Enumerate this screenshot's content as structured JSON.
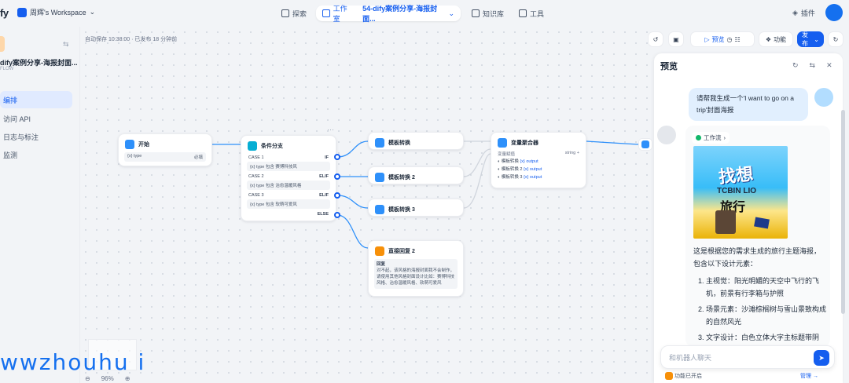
{
  "header": {
    "logo": "fy",
    "workspace": "周辉's Workspace",
    "nav": {
      "explore": "探索",
      "studio": "工作室",
      "app_title": "54-dify案例分享-海报封面...",
      "knowledge": "知识库",
      "tools": "工具"
    },
    "plugins": "插件"
  },
  "sidebar": {
    "app_name": "dify案例分享-海报封面...",
    "app_type": "FLOW",
    "items": [
      {
        "label": "编排"
      },
      {
        "label": "访问 API"
      },
      {
        "label": "日志与标注"
      },
      {
        "label": "监测"
      }
    ]
  },
  "canvas": {
    "autosave": "自动保存 10:38:00 · 已发布 18 分钟前",
    "zoom": "96%",
    "nodes": {
      "start": {
        "title": "开始",
        "var": "{x} type",
        "req": "必填"
      },
      "if": {
        "title": "条件分支",
        "case1": "CASE 1",
        "if": "IF",
        "cond1": "{x} type 包含 赛博科技风",
        "case2": "CASE 2",
        "elif1": "ELIF",
        "cond2": "{x} type 包含 治愈温暖风格",
        "case3": "CASE 3",
        "elif2": "ELIF",
        "cond3": "{x} type 包含 软萌可爱风",
        "else": "ELSE"
      },
      "t1": {
        "title": "模板转换"
      },
      "t2": {
        "title": "模板转换 2"
      },
      "t3": {
        "title": "模板转换 3"
      },
      "agg": {
        "title": "变量聚合器",
        "group": "变量赋值",
        "type": "string",
        "add": "+",
        "r1": "模板转换",
        "r2": "模板转换 2",
        "r3": "模板转换 3",
        "out": "{x} output"
      },
      "reply": {
        "title": "直接回复 2",
        "label": "回复",
        "text": "对不起，该风格的海报封面我不会制作，请使用其他风格封面设计比如：赛博科技风格、治愈温暖风格、软萌可爱风"
      }
    }
  },
  "toolbar": {
    "preview": "预览",
    "features": "功能",
    "publish": "发布"
  },
  "preview": {
    "title": "预览",
    "user_msg": "请帮我生成一个'I want to go on a trip'封面海报",
    "workflow_tag": "工作流",
    "poster": {
      "t1": "找想",
      "t2": "TCBIN LIO",
      "t3": "旅行"
    },
    "answer_intro": "这是根据您的需求生成的旅行主题海报，包含以下设计元素：",
    "points": [
      "主视觉：阳光明媚的天空中飞行的飞机，前景有行李箱与护照",
      "场景元素：沙滩棕榈树与雪山景致构成的自然风光",
      "文字设计：白色立体大字主标题带阴影，灰白色副标题"
    ],
    "input_placeholder": "和机器人聊天",
    "features_on": "功能已开启",
    "manage": "管理 →"
  },
  "watermark": "wwzhouhu i",
  "colors": {
    "primary": "#155eef",
    "bg": "#f2f4f7"
  }
}
